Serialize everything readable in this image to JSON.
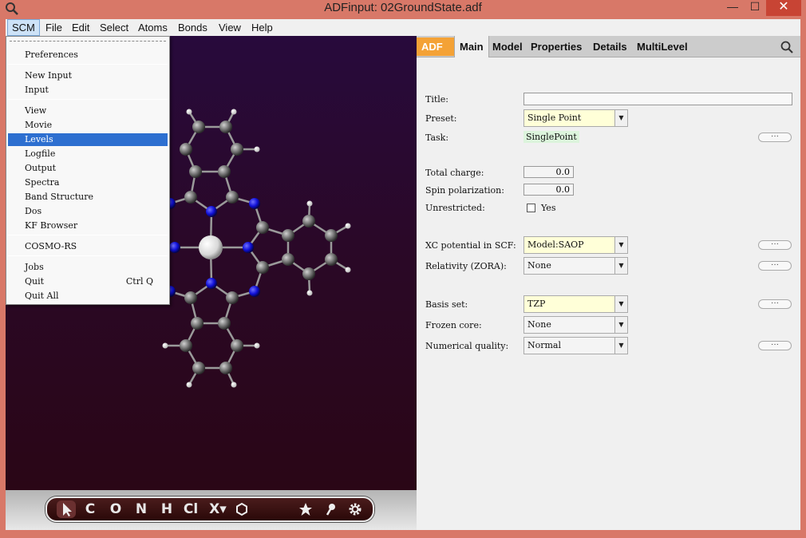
{
  "window": {
    "title": "ADFinput: 02GroundState.adf",
    "app_icon": "magnifier-icon",
    "minimize": "—",
    "maximize": "☐",
    "close": "✕"
  },
  "menubar": {
    "items": [
      "SCM",
      "File",
      "Edit",
      "Select",
      "Atoms",
      "Bonds",
      "View",
      "Help"
    ],
    "active": "SCM"
  },
  "scm_menu": {
    "items": [
      {
        "label": "Preferences"
      },
      {
        "label": "New Input"
      },
      {
        "label": "Input"
      },
      {
        "label": "View"
      },
      {
        "label": "Movie"
      },
      {
        "label": "Levels",
        "highlighted": true
      },
      {
        "label": "Logfile"
      },
      {
        "label": "Output"
      },
      {
        "label": "Spectra"
      },
      {
        "label": "Band Structure"
      },
      {
        "label": "Dos"
      },
      {
        "label": "KF Browser"
      },
      {
        "label": "COSMO-RS"
      },
      {
        "label": "Jobs"
      },
      {
        "label": "Quit",
        "shortcut": "Ctrl Q"
      },
      {
        "label": "Quit All"
      }
    ]
  },
  "panel": {
    "tabs": [
      "ADF",
      "Main",
      "Model",
      "Properties",
      "Details",
      "MultiLevel"
    ],
    "active_tab": "Main",
    "search_icon": "search-icon",
    "fields": {
      "title": {
        "label": "Title:",
        "value": ""
      },
      "preset": {
        "label": "Preset:",
        "value": "Single Point"
      },
      "task": {
        "label": "Task:",
        "value": "SinglePoint"
      },
      "total_charge": {
        "label": "Total charge:",
        "value": "0.0"
      },
      "spin_polarization": {
        "label": "Spin polarization:",
        "value": "0.0"
      },
      "unrestricted": {
        "label": "Unrestricted:",
        "checkbox_label": "Yes",
        "checked": false
      },
      "xc_potential": {
        "label": "XC potential in SCF:",
        "value": "Model:SAOP"
      },
      "relativity": {
        "label": "Relativity (ZORA):",
        "value": "None"
      },
      "basis_set": {
        "label": "Basis set:",
        "value": "TZP"
      },
      "frozen_core": {
        "label": "Frozen core:",
        "value": "None"
      },
      "numerical_quality": {
        "label": "Numerical quality:",
        "value": "Normal"
      }
    },
    "more_button": "···"
  },
  "toolbar": {
    "tools": [
      "pointer",
      "C",
      "O",
      "N",
      "H",
      "Cl",
      "X",
      "ring",
      "star",
      "pin",
      "gear"
    ],
    "labels": {
      "C": "C",
      "O": "O",
      "N": "N",
      "H": "H",
      "Cl": "Cl",
      "X": "X▾"
    }
  },
  "colors": {
    "accent": "#f4a236",
    "highlight": "#2d6fd0",
    "titlebar": "#d87868",
    "carbon": "#6e6e6e",
    "nitrogen": "#1010d8",
    "hydrogen": "#ffffff",
    "metal": "#e8e8e8"
  }
}
